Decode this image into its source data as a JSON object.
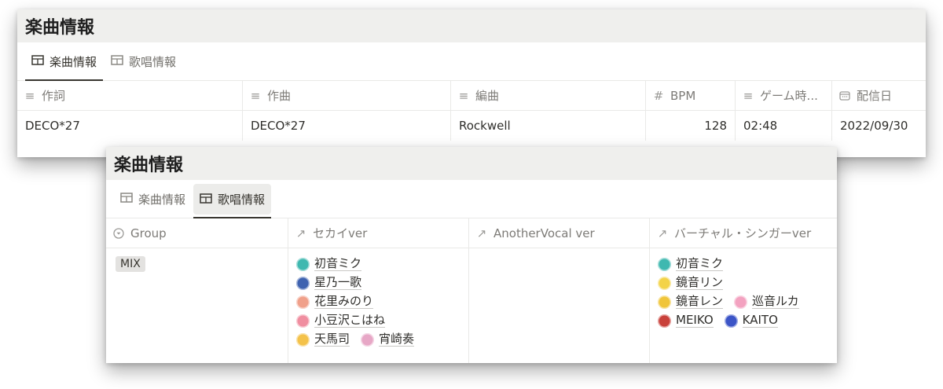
{
  "card1": {
    "title": "楽曲情報",
    "tabs": [
      {
        "label": "楽曲情報",
        "active": true,
        "icon": "table-icon"
      },
      {
        "label": "歌唱情報",
        "active": false,
        "icon": "table-icon"
      }
    ],
    "columns": [
      {
        "label": "作詞",
        "icon": "text-lines-icon"
      },
      {
        "label": "作曲",
        "icon": "text-lines-icon"
      },
      {
        "label": "編曲",
        "icon": "text-lines-icon"
      },
      {
        "label": "BPM",
        "icon": "hash-icon"
      },
      {
        "label": "ゲーム時...",
        "icon": "text-lines-icon"
      },
      {
        "label": "配信日",
        "icon": "calendar-icon"
      }
    ],
    "row": {
      "lyrics": "DECO*27",
      "composer": "DECO*27",
      "arranger": "Rockwell",
      "bpm": "128",
      "game_time": "02:48",
      "release_date": "2022/09/30"
    }
  },
  "card2": {
    "title": "楽曲情報",
    "tabs": [
      {
        "label": "楽曲情報",
        "active": false,
        "icon": "table-icon"
      },
      {
        "label": "歌唱情報",
        "active": true,
        "icon": "table-icon"
      }
    ],
    "columns": [
      {
        "label": "Group",
        "icon": "select-icon"
      },
      {
        "label": "セカイver",
        "icon": "relation-arrow-icon"
      },
      {
        "label": "AnotherVocal ver",
        "icon": "relation-arrow-icon"
      },
      {
        "label": "バーチャル・シンガーver",
        "icon": "relation-arrow-icon"
      }
    ],
    "group": "MIX",
    "sekai_singers": [
      [
        "初音ミク"
      ],
      [
        "星乃一歌"
      ],
      [
        "花里みのり"
      ],
      [
        "小豆沢こはね"
      ],
      [
        "天馬司",
        "宵崎奏"
      ]
    ],
    "virtual_singers": [
      [
        "初音ミク"
      ],
      [
        "鏡音リン"
      ],
      [
        "鏡音レン",
        "巡音ルカ"
      ],
      [
        "MEIKO",
        "KAITO"
      ]
    ],
    "avatar_colors": {
      "初音ミク": "#3fb8b0",
      "星乃一歌": "#3f63b0",
      "花里みのり": "#f0a08a",
      "小豆沢こはね": "#f08ea0",
      "天馬司": "#f4c24a",
      "宵崎奏": "#e7a7c6",
      "鏡音リン": "#f3d348",
      "鏡音レン": "#f0c53a",
      "巡音ルカ": "#f3a2c0",
      "MEIKO": "#c9413b",
      "KAITO": "#3c55c7"
    }
  }
}
